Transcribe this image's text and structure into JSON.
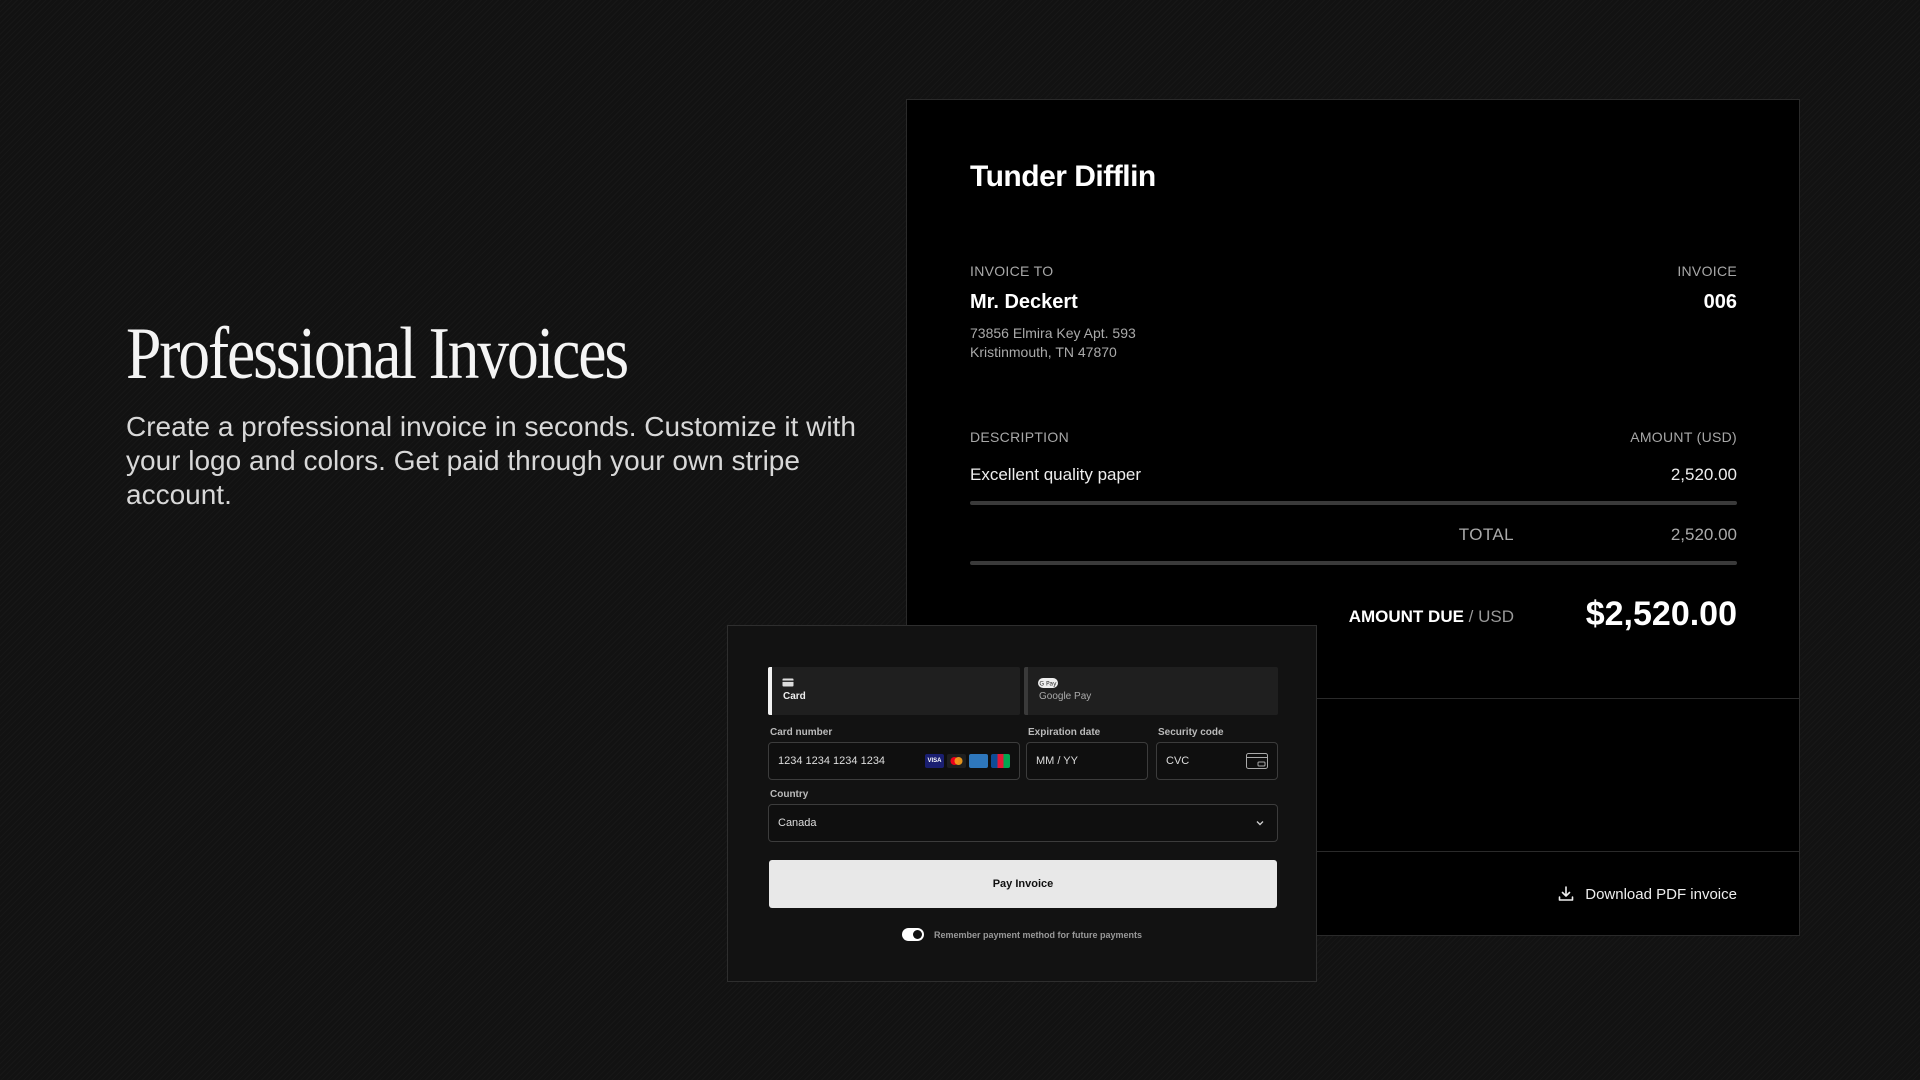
{
  "hero": {
    "title": "Professional Invoices",
    "description": "Create a professional invoice in seconds. Customize it with your logo and colors. Get paid through your own stripe account."
  },
  "invoice": {
    "company": "Tunder Difflin",
    "to_label": "INVOICE TO",
    "to_name": "Mr. Deckert",
    "address_line1": "73856 Elmira Key Apt. 593",
    "address_line2": "Kristinmouth, TN 47870",
    "number_label": "INVOICE",
    "number": "006",
    "description_label": "DESCRIPTION",
    "amount_label": "AMOUNT (USD)",
    "items": [
      {
        "description": "Excellent quality paper",
        "amount": "2,520.00"
      }
    ],
    "total_label": "TOTAL",
    "total_value": "2,520.00",
    "amount_due_label": "AMOUNT DUE",
    "amount_due_currency": " / USD",
    "amount_due_value": "$2,520.00",
    "download_label": "Download PDF invoice"
  },
  "payment": {
    "tabs": [
      {
        "label": "Card",
        "icon": "card-icon"
      },
      {
        "label": "Google Pay",
        "icon": "google-pay-icon"
      }
    ],
    "card_number_label": "Card number",
    "card_number_placeholder": "1234 1234 1234 1234",
    "brands": [
      "visa",
      "mastercard",
      "amex",
      "jcb"
    ],
    "expiration_label": "Expiration date",
    "expiration_placeholder": "MM / YY",
    "security_label": "Security code",
    "security_placeholder": "CVC",
    "country_label": "Country",
    "country_value": "Canada",
    "pay_button": "Pay Invoice",
    "remember_label": "Remember payment method for future payments"
  }
}
